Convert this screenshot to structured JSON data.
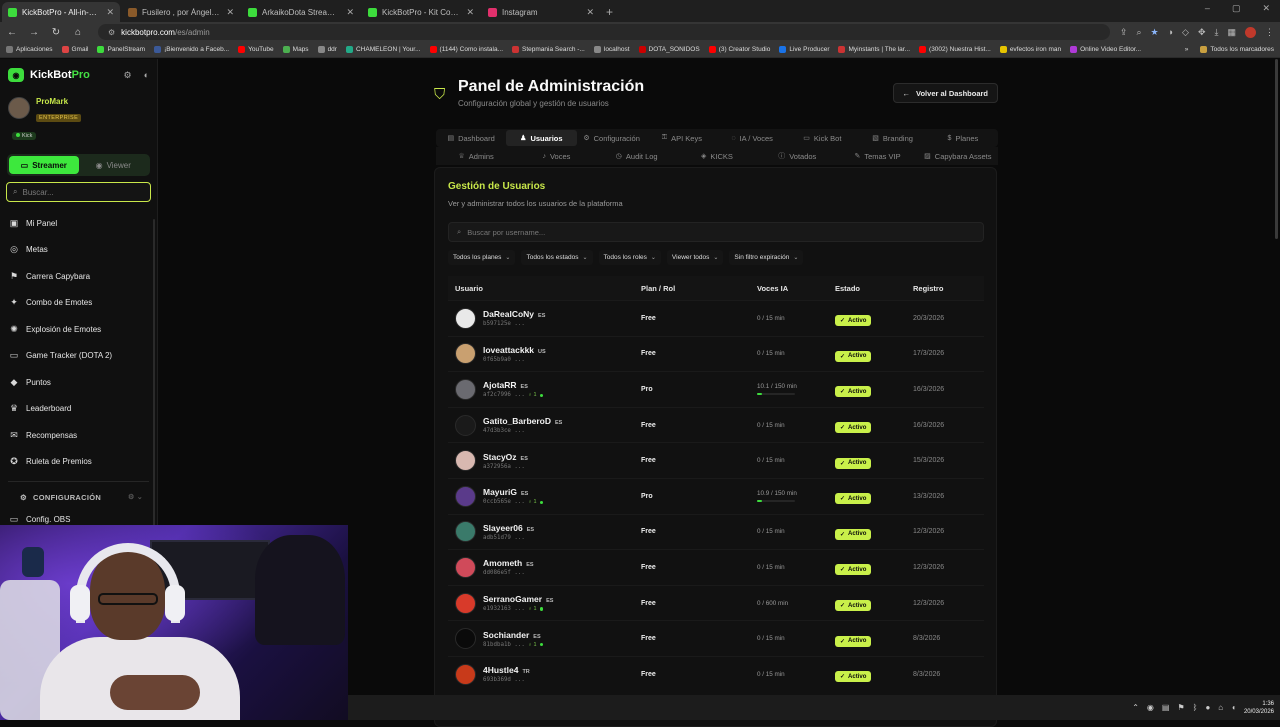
{
  "browser": {
    "tabs": [
      {
        "title": "KickBotPro - All-in-One Stream",
        "color": "#3ddc3d",
        "active": true
      },
      {
        "title": "Fusilero , por Ángel Sacristán ...",
        "color": "#8a5a2a",
        "active": false
      },
      {
        "title": "ArkaikoDota Stream - Watch L...",
        "color": "#3ddc3d",
        "active": false
      },
      {
        "title": "KickBotPro - Kit Completo de S...",
        "color": "#3ddc3d",
        "active": false
      },
      {
        "title": "Instagram",
        "color": "#e1306c",
        "active": false
      }
    ],
    "url_host": "kickbotpro.com",
    "url_path": "/es/admin",
    "bookmarks": [
      "Aplicaciones",
      "Gmail",
      "PanelStream",
      "¡Bienvenido a Faceb...",
      "YouTube",
      "Maps",
      "ddr",
      "CHAMELEON | Your...",
      "(1144) Como instala...",
      "Stepmania Search -...",
      "localhost",
      "DOTA_SONIDOS",
      "(3) Creator Studio",
      "Live Producer",
      "Myinstants | The lar...",
      "(3002) Nuestra Hist...",
      "evfectos iron man",
      "Online Video Editor..."
    ],
    "all_bookmarks": "Todos los marcadores"
  },
  "sidebar": {
    "logo_main": "KickBot",
    "logo_accent": "Pro",
    "user_name": "ProMark",
    "user_tier": "ENTERPRISE",
    "platform": "Kick",
    "mode_streamer": "Streamer",
    "mode_viewer": "Viewer",
    "search_placeholder": "Buscar...",
    "items": [
      {
        "label": "Mi Panel",
        "icon": "▣"
      },
      {
        "label": "Metas",
        "icon": "◎"
      },
      {
        "label": "Carrera Capybara",
        "icon": "⚑"
      },
      {
        "label": "Combo de Emotes",
        "icon": "✦"
      },
      {
        "label": "Explosión de Emotes",
        "icon": "✺"
      },
      {
        "label": "Game Tracker (DOTA 2)",
        "icon": "▭"
      },
      {
        "label": "Puntos",
        "icon": "◆"
      },
      {
        "label": "Leaderboard",
        "icon": "♛"
      },
      {
        "label": "Recompensas",
        "icon": "✉"
      },
      {
        "label": "Ruleta de Premios",
        "icon": "✪"
      }
    ],
    "section": "CONFIGURACIÓN",
    "config_item": "Config. OBS"
  },
  "header": {
    "title": "Panel de Administración",
    "subtitle": "Configuración global y gestión de usuarios",
    "back_label": "Volver al Dashboard"
  },
  "tabs_row1": [
    {
      "label": "Dashboard",
      "icon": "▤",
      "active": false
    },
    {
      "label": "Usuarios",
      "icon": "♟",
      "active": true
    },
    {
      "label": "Configuración",
      "icon": "⚙",
      "active": false
    },
    {
      "label": "API Keys",
      "icon": "⚿",
      "active": false
    },
    {
      "label": "IA / Voces",
      "icon": "◌",
      "active": false
    },
    {
      "label": "Kick Bot",
      "icon": "▭",
      "active": false
    },
    {
      "label": "Branding",
      "icon": "▧",
      "active": false
    },
    {
      "label": "Planes",
      "icon": "$",
      "active": false
    }
  ],
  "tabs_row2": [
    {
      "label": "Admins",
      "icon": "♕"
    },
    {
      "label": "Voces",
      "icon": "♪"
    },
    {
      "label": "Audit Log",
      "icon": "◷"
    },
    {
      "label": "KICKS",
      "icon": "◈"
    },
    {
      "label": "Votados",
      "icon": "ⓘ"
    },
    {
      "label": "Temas VIP",
      "icon": "✎"
    },
    {
      "label": "Capybara Assets",
      "icon": "▨"
    }
  ],
  "users_card": {
    "title": "Gestión de Usuarios",
    "subtitle": "Ver y administrar todos los usuarios de la plataforma",
    "search_placeholder": "Buscar por username...",
    "filters": [
      "Todos los planes",
      "Todos los estados",
      "Todos los roles",
      "Viewer todos",
      "Sin filtro expiración"
    ],
    "columns": [
      "Usuario",
      "Plan / Rol",
      "Voces IA",
      "Estado",
      "Registro"
    ],
    "rows": [
      {
        "name": "DaRealCoNy",
        "lang": "ES",
        "id": "b597125e ...",
        "extra": "",
        "plan": "Free",
        "voices": "0 / 15 min",
        "voices_fraction": 0,
        "status": "Activo",
        "date": "20/3/2026",
        "avatar": "#e9e9e9"
      },
      {
        "name": "loveattackkk",
        "lang": "US",
        "id": "0f65b9a0 ...",
        "extra": "",
        "plan": "Free",
        "voices": "0 / 15 min",
        "voices_fraction": 0,
        "status": "Activo",
        "date": "17/3/2026",
        "avatar": "#c9a070"
      },
      {
        "name": "AjotaRR",
        "lang": "ES",
        "id": "af2c7996 ...",
        "extra": "1",
        "plan": "Pro",
        "voices": "10.1 / 150 min",
        "voices_fraction": 0.07,
        "status": "Activo",
        "date": "16/3/2026",
        "avatar": "#6a6a70"
      },
      {
        "name": "Gatito_BarberoD",
        "lang": "ES",
        "id": "47d3b3ce ...",
        "extra": "",
        "plan": "Free",
        "voices": "0 / 15 min",
        "voices_fraction": 0,
        "status": "Activo",
        "date": "16/3/2026",
        "avatar": "#1a1a1a"
      },
      {
        "name": "StacyOz",
        "lang": "ES",
        "id": "a372956a ...",
        "extra": "",
        "plan": "Free",
        "voices": "0 / 15 min",
        "voices_fraction": 0,
        "status": "Activo",
        "date": "15/3/2026",
        "avatar": "#d8b8b0"
      },
      {
        "name": "MayuriG",
        "lang": "ES",
        "id": "0ccb565e ...",
        "extra": "1",
        "plan": "Pro",
        "voices": "10.9 / 150 min",
        "voices_fraction": 0.07,
        "status": "Activo",
        "date": "13/3/2026",
        "avatar": "#5a3a8a"
      },
      {
        "name": "Slayeer06",
        "lang": "ES",
        "id": "adb51d79 ...",
        "extra": "",
        "plan": "Free",
        "voices": "0 / 15 min",
        "voices_fraction": 0,
        "status": "Activo",
        "date": "12/3/2026",
        "avatar": "#3a7a6a"
      },
      {
        "name": "Amometh",
        "lang": "ES",
        "id": "dd086e5f ...",
        "extra": "",
        "plan": "Free",
        "voices": "0 / 15 min",
        "voices_fraction": 0,
        "status": "Activo",
        "date": "12/3/2026",
        "avatar": "#d04a5a"
      },
      {
        "name": "SerranoGamer",
        "lang": "ES",
        "id": "e1932163 ...",
        "extra": "1",
        "plan": "Free",
        "voices": "0 / 600 min",
        "voices_fraction": 0,
        "status": "Activo",
        "date": "12/3/2026",
        "avatar": "#d83a2a"
      },
      {
        "name": "Sochiander",
        "lang": "ES",
        "id": "81bdba1b ...",
        "extra": "1",
        "plan": "Free",
        "voices": "0 / 15 min",
        "voices_fraction": 0,
        "status": "Activo",
        "date": "8/3/2026",
        "avatar": "#0a0a0a"
      },
      {
        "name": "4Hustle4",
        "lang": "TR",
        "id": "693b369d ...",
        "extra": "",
        "plan": "Free",
        "voices": "0 / 15 min",
        "voices_fraction": 0,
        "status": "Activo",
        "date": "8/3/2026",
        "avatar": "#c83a1a"
      }
    ]
  },
  "taskbar": {
    "time": "1:36",
    "date": "20/03/2026"
  }
}
